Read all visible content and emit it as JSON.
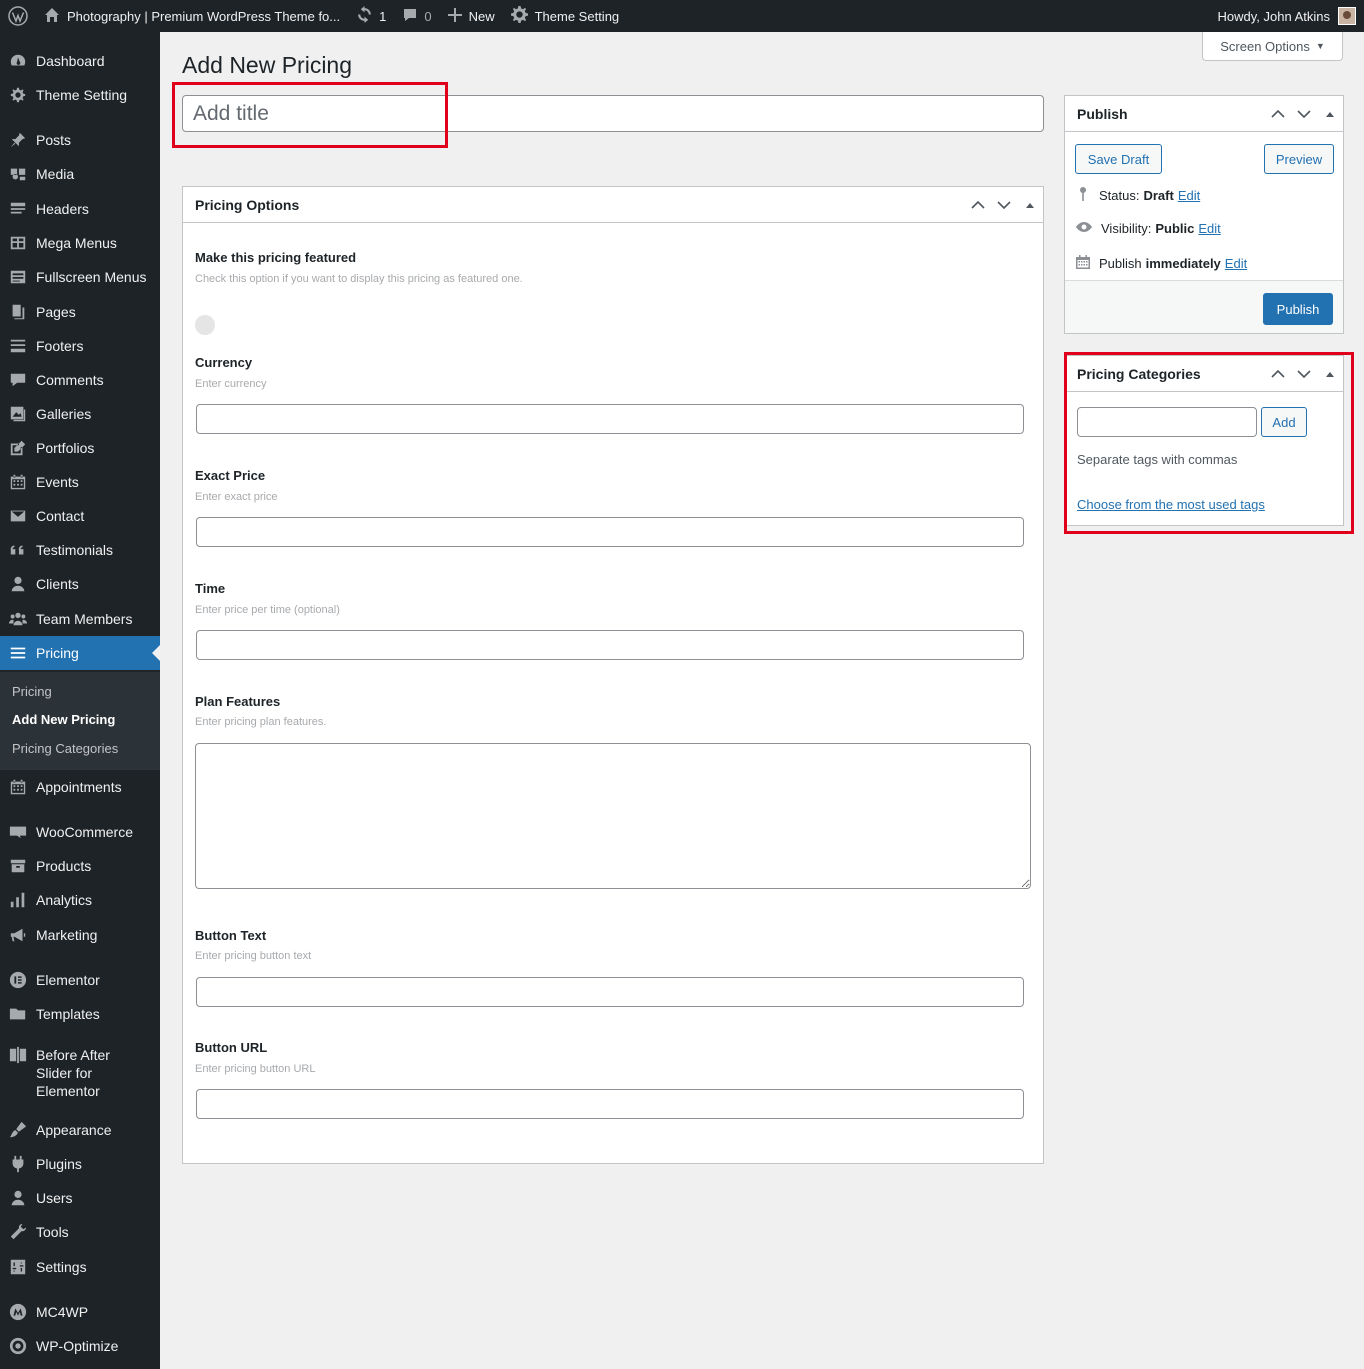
{
  "adminbar": {
    "site_name": "Photography | Premium WordPress Theme fo...",
    "updates_count": "1",
    "comments_count": "0",
    "new_label": "New",
    "theme_setting_label": "Theme Setting",
    "howdy": "Howdy, John Atkins"
  },
  "sidebar": {
    "items": [
      {
        "label": "Dashboard",
        "icon": "dashboard-icon"
      },
      {
        "label": "Theme Setting",
        "icon": "gear-icon"
      },
      {
        "label": "Posts",
        "icon": "pin-icon"
      },
      {
        "label": "Media",
        "icon": "media-icon"
      },
      {
        "label": "Headers",
        "icon": "header-icon"
      },
      {
        "label": "Mega Menus",
        "icon": "grid-icon"
      },
      {
        "label": "Fullscreen Menus",
        "icon": "menu-icon"
      },
      {
        "label": "Pages",
        "icon": "page-icon"
      },
      {
        "label": "Footers",
        "icon": "footer-icon"
      },
      {
        "label": "Comments",
        "icon": "comment-icon"
      },
      {
        "label": "Galleries",
        "icon": "gallery-icon"
      },
      {
        "label": "Portfolios",
        "icon": "portfolio-icon"
      },
      {
        "label": "Events",
        "icon": "calendar-icon"
      },
      {
        "label": "Contact",
        "icon": "mail-icon"
      },
      {
        "label": "Testimonials",
        "icon": "quote-icon"
      },
      {
        "label": "Clients",
        "icon": "user-icon"
      },
      {
        "label": "Team Members",
        "icon": "team-icon"
      },
      {
        "label": "Pricing",
        "icon": "list-icon"
      },
      {
        "label": "Appointments",
        "icon": "calendar-icon"
      },
      {
        "label": "WooCommerce",
        "icon": "woo-icon"
      },
      {
        "label": "Products",
        "icon": "archive-icon"
      },
      {
        "label": "Analytics",
        "icon": "chart-bar-icon"
      },
      {
        "label": "Marketing",
        "icon": "megaphone-icon"
      },
      {
        "label": "Elementor",
        "icon": "elementor-icon"
      },
      {
        "label": "Templates",
        "icon": "folder-icon"
      },
      {
        "label": "Before After Slider for Elementor",
        "icon": "slider-icon"
      },
      {
        "label": "Appearance",
        "icon": "brush-icon"
      },
      {
        "label": "Plugins",
        "icon": "plugin-icon"
      },
      {
        "label": "Users",
        "icon": "user-icon"
      },
      {
        "label": "Tools",
        "icon": "wrench-icon"
      },
      {
        "label": "Settings",
        "icon": "settings-icon"
      },
      {
        "label": "MC4WP",
        "icon": "mc4wp-icon"
      },
      {
        "label": "WP-Optimize",
        "icon": "optimize-icon"
      }
    ],
    "submenu": [
      "Pricing",
      "Add New Pricing",
      "Pricing Categories"
    ]
  },
  "screen_options": "Screen Options",
  "page_title": "Add New Pricing",
  "title_placeholder": "Add title",
  "pricing_options": {
    "heading": "Pricing Options",
    "featured": {
      "label": "Make this pricing featured",
      "desc": "Check this option if you want to display this pricing as featured one."
    },
    "currency": {
      "label": "Currency",
      "desc": "Enter currency",
      "value": ""
    },
    "exact_price": {
      "label": "Exact Price",
      "desc": "Enter exact price",
      "value": ""
    },
    "time": {
      "label": "Time",
      "desc": "Enter price per time (optional)",
      "value": ""
    },
    "plan_features": {
      "label": "Plan Features",
      "desc": "Enter pricing plan features.",
      "value": ""
    },
    "button_text": {
      "label": "Button Text",
      "desc": "Enter pricing button text",
      "value": ""
    },
    "button_url": {
      "label": "Button URL",
      "desc": "Enter pricing button URL",
      "value": ""
    }
  },
  "publish": {
    "heading": "Publish",
    "save_draft": "Save Draft",
    "preview": "Preview",
    "status_label": "Status:",
    "status_value": "Draft",
    "visibility_label": "Visibility:",
    "visibility_value": "Public",
    "publish_label": "Publish",
    "publish_value": "immediately",
    "edit": "Edit",
    "publish_button": "Publish"
  },
  "pricing_categories": {
    "heading": "Pricing Categories",
    "add_button": "Add",
    "hint": "Separate tags with commas",
    "choose_link": "Choose from the most used tags",
    "value": ""
  },
  "colors": {
    "sidebar_bg": "#1d2327",
    "accent": "#2271b1",
    "highlight": "#e0001b"
  }
}
